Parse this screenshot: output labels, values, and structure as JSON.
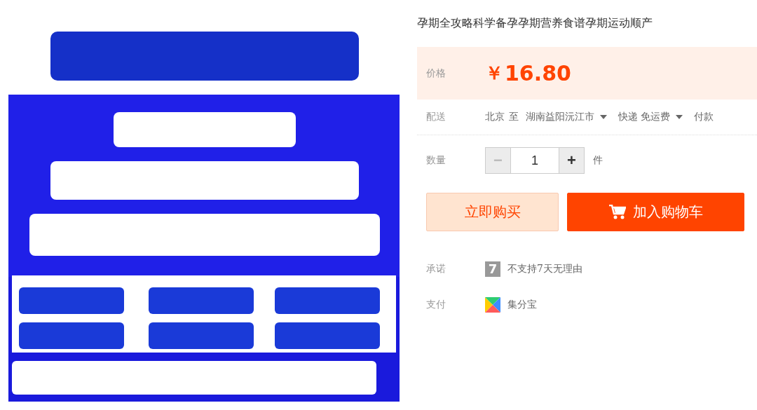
{
  "title": "孕期全攻略科学备孕孕期营养食谱孕期运动顺产",
  "price": {
    "label": "价格",
    "currency": "￥",
    "amount": "16.80"
  },
  "delivery": {
    "label": "配送",
    "from": "北京",
    "to_word": "至",
    "destination": "湖南益阳沅江市",
    "shipping": "快递 免运费",
    "payment": "付款"
  },
  "quantity": {
    "label": "数量",
    "minus": "−",
    "value": "1",
    "plus": "+",
    "unit": "件",
    "minus_disabled": true
  },
  "buttons": [
    {
      "kind": "buy",
      "label": "立即购买"
    },
    {
      "kind": "cart",
      "label": "加入购物车"
    }
  ],
  "services": [
    {
      "kind": "promise",
      "label": "承诺",
      "badge": "7",
      "text": "不支持7天无理由"
    },
    {
      "kind": "payment",
      "label": "支付",
      "text": "集分宝"
    }
  ]
}
